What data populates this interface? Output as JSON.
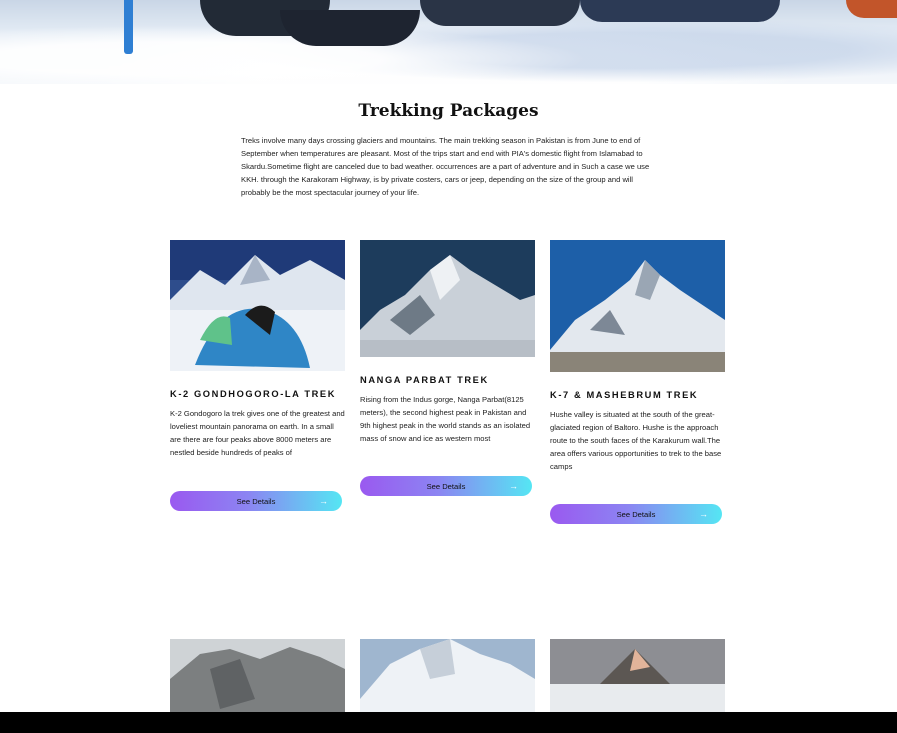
{
  "hero": {
    "image": "snow-camp-photo"
  },
  "section": {
    "title": "Trekking Packages",
    "intro": "Treks involve many days crossing glaciers and mountains. The main trekking season in Pakistan is from June to end of September when temperatures are pleasant. Most of the trips start and end with PIA's domestic flight from Islamabad to Skardu.Sometime flight are canceled due to bad weather. occurrences are a part of adventure and in Such a case we use KKH. through the Karakoram Highway, is by private costers, cars or jeep, depending on the size of the group and will probably be the most spectacular journey of your life."
  },
  "cards": [
    {
      "title": "K-2 GONDHOGORO-LA TREK",
      "desc": "K-2 Gondogoro la trek gives one of the greatest and loveliest mountain panorama on earth. In a small are there are four peaks above 8000 meters are nestled beside hundreds of peaks of",
      "button": "See Details",
      "icon": "arrow-right-icon"
    },
    {
      "title": "NANGA PARBAT TREK",
      "desc": "Rising from the Indus gorge, Nanga Parbat(8125 meters), the second highest peak in Pakistan and 9th highest peak in the world stands as an isolated mass of snow and ice as western most",
      "button": "See Details",
      "icon": "arrow-right-icon"
    },
    {
      "title": "K-7 & MASHEBRUM TREK",
      "desc": "Hushe valley is situated at the south of the great-glaciated region of Baltoro. Hushe is the approach route to the south faces of the Karakurum wall.The area offers various opportunities to trek to the base camps",
      "button": "See Details",
      "icon": "arrow-right-icon"
    }
  ],
  "colors": {
    "button_start": "#9a59f0",
    "button_end": "#55e6f3",
    "footer_bar": "#000000"
  }
}
